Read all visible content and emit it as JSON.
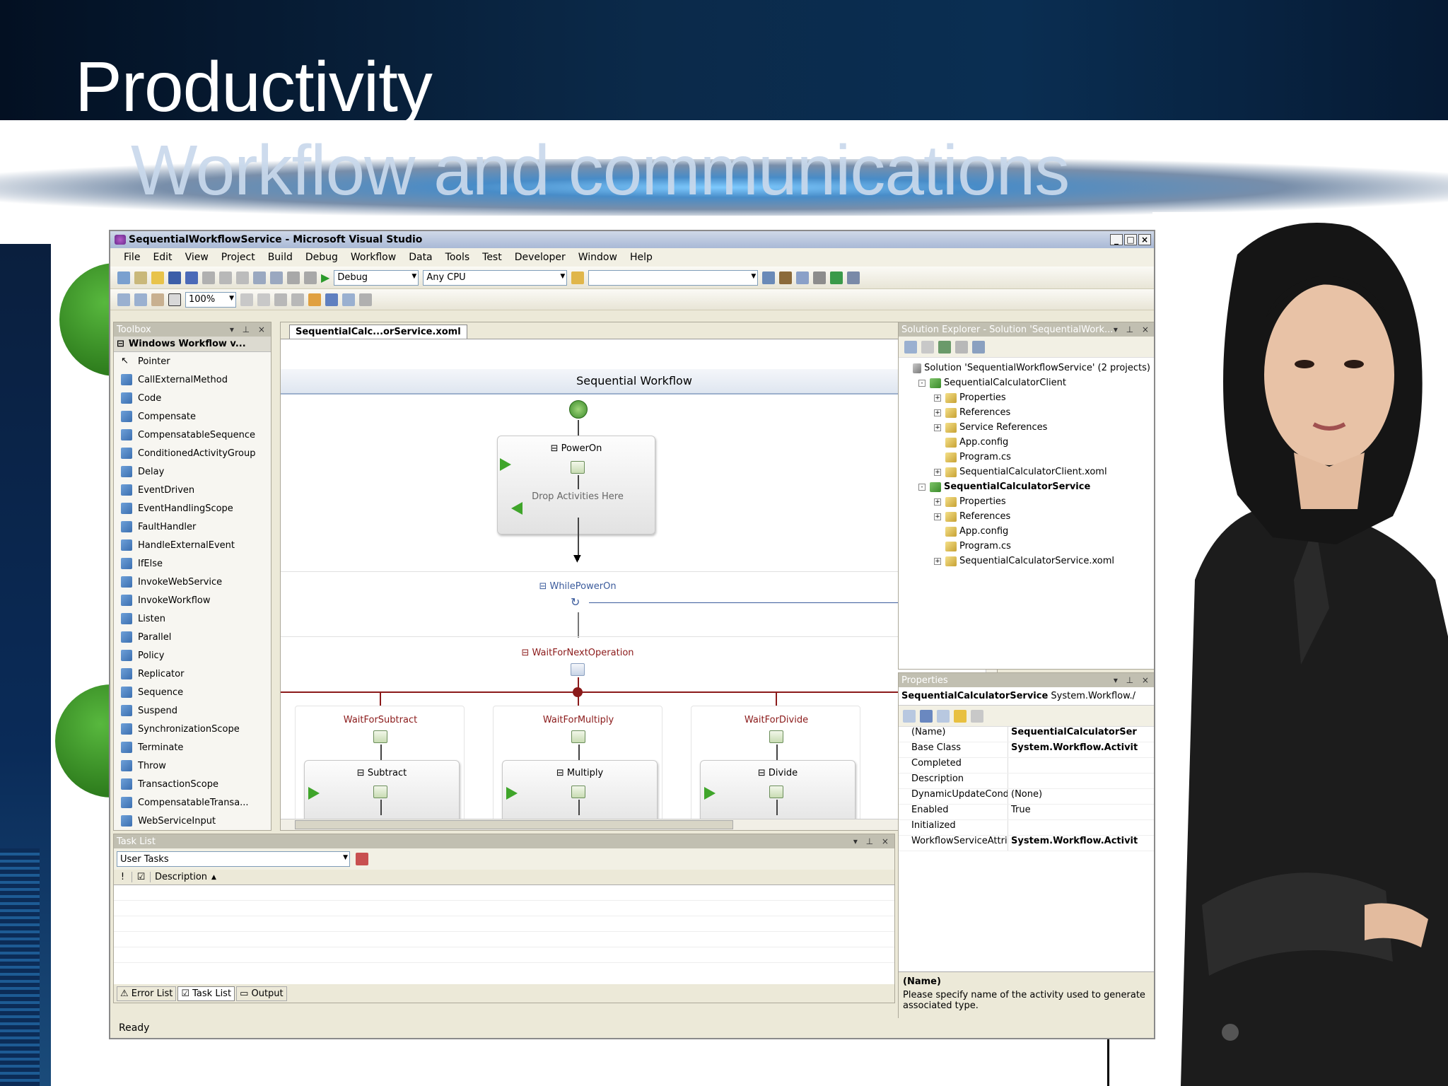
{
  "slide": {
    "title": "Productivity",
    "subtitle": "Workflow and communications"
  },
  "window": {
    "title": "SequentialWorkflowService - Microsoft Visual Studio",
    "controls": [
      "_",
      "□",
      "×"
    ]
  },
  "menu": [
    "File",
    "Edit",
    "View",
    "Project",
    "Build",
    "Debug",
    "Workflow",
    "Data",
    "Tools",
    "Test",
    "Developer",
    "Window",
    "Help"
  ],
  "toolbar": {
    "config": "Debug",
    "platform": "Any CPU",
    "zoom": "100%"
  },
  "toolbox": {
    "header": "Toolbox",
    "group": "Windows Workflow v...",
    "items": [
      "Pointer",
      "CallExternalMethod",
      "Code",
      "Compensate",
      "CompensatableSequence",
      "ConditionedActivityGroup",
      "Delay",
      "EventDriven",
      "EventHandlingScope",
      "FaultHandler",
      "HandleExternalEvent",
      "IfElse",
      "InvokeWebService",
      "InvokeWorkflow",
      "Listen",
      "Parallel",
      "Policy",
      "Replicator",
      "Sequence",
      "Suspend",
      "SynchronizationScope",
      "Terminate",
      "Throw",
      "TransactionScope",
      "CompensatableTransa...",
      "WebServiceInput"
    ]
  },
  "designer": {
    "tab": "SequentialCalc...orService.xoml",
    "header": "Sequential Workflow",
    "power_on": "PowerOn",
    "drop_hint": "Drop Activities Here",
    "while": "WhilePowerOn",
    "wait_next": "WaitForNextOperation",
    "branches": [
      {
        "label": "WaitForSubtract",
        "activity": "Subtract"
      },
      {
        "label": "WaitForMultiply",
        "activity": "Multiply"
      },
      {
        "label": "WaitForDivide",
        "activity": "Divide"
      }
    ]
  },
  "solution_explorer": {
    "header": "Solution Explorer - Solution 'SequentialWork...",
    "rows": [
      {
        "text": "Solution 'SequentialWorkflowService' (2 projects)",
        "level": 0,
        "exp": ""
      },
      {
        "text": "SequentialCalculatorClient",
        "level": 1,
        "exp": "-"
      },
      {
        "text": "Properties",
        "level": 2,
        "exp": "+"
      },
      {
        "text": "References",
        "level": 2,
        "exp": "+"
      },
      {
        "text": "Service References",
        "level": 2,
        "exp": "+"
      },
      {
        "text": "App.config",
        "level": 2,
        "exp": ""
      },
      {
        "text": "Program.cs",
        "level": 2,
        "exp": ""
      },
      {
        "text": "SequentialCalculatorClient.xoml",
        "level": 2,
        "exp": "+"
      },
      {
        "text": "SequentialCalculatorService",
        "level": 1,
        "exp": "-"
      },
      {
        "text": "Properties",
        "level": 2,
        "exp": "+"
      },
      {
        "text": "References",
        "level": 2,
        "exp": "+"
      },
      {
        "text": "App.config",
        "level": 2,
        "exp": ""
      },
      {
        "text": "Program.cs",
        "level": 2,
        "exp": ""
      },
      {
        "text": "SequentialCalculatorService.xoml",
        "level": 2,
        "exp": "+"
      }
    ]
  },
  "properties": {
    "header": "Properties",
    "object": "SequentialCalculatorService",
    "object_type": "System.Workflow./",
    "rows": [
      {
        "k": "(Name)",
        "v": "SequentialCalculatorSer"
      },
      {
        "k": "Base Class",
        "v": "System.Workflow.Activit"
      },
      {
        "k": "Completed",
        "v": ""
      },
      {
        "k": "Description",
        "v": ""
      },
      {
        "k": "DynamicUpdateConditio",
        "v": "(None)"
      },
      {
        "k": "Enabled",
        "v": "True"
      },
      {
        "k": "Initialized",
        "v": ""
      },
      {
        "k": "WorkflowServiceAttribu",
        "v": "System.Workflow.Activit"
      }
    ],
    "help_title": "(Name)",
    "help_text": "Please specify name of the activity used to generate associated type."
  },
  "task_list": {
    "header": "Task List",
    "filter": "User Tasks",
    "col_bang": "!",
    "col_description": "Description",
    "tabs": [
      "Error List",
      "Task List",
      "Output"
    ]
  },
  "status": "Ready"
}
